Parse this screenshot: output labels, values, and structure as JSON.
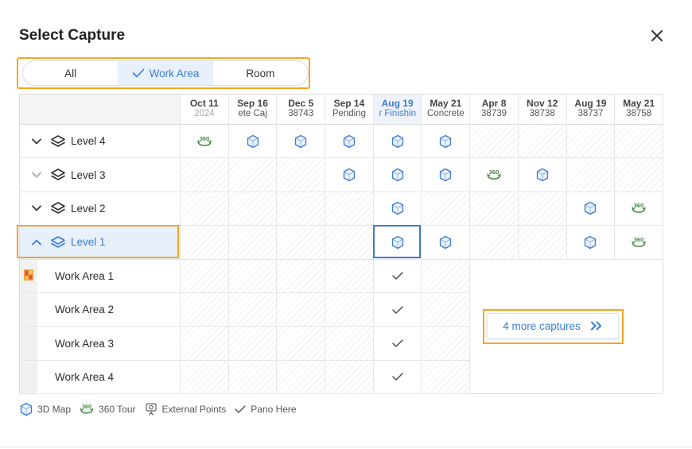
{
  "dialog": {
    "title": "Select Capture",
    "close_icon": "close-icon"
  },
  "tabs": [
    {
      "label": "All",
      "active": false
    },
    {
      "label": "Work Area",
      "active": true,
      "icon": "check-icon"
    },
    {
      "label": "Room",
      "active": false
    }
  ],
  "columns": [
    {
      "date": "Oct 11",
      "sub": "2024",
      "muted": true
    },
    {
      "date": "Sep 16",
      "sub": "ete   Caj"
    },
    {
      "date": "Dec 5",
      "sub": "38743"
    },
    {
      "date": "Sep 14",
      "sub": "Pending"
    },
    {
      "date": "Aug 19",
      "sub": "r Finishin",
      "highlight": true
    },
    {
      "date": "May 21",
      "sub": "Concrete"
    },
    {
      "date": "Apr 8",
      "sub": "38739"
    },
    {
      "date": "Nov 12",
      "sub": "38738"
    },
    {
      "date": "Aug 19",
      "sub": "38737"
    },
    {
      "date": "May 21",
      "sub": "38758"
    }
  ],
  "levels": [
    {
      "label": "Level 4",
      "expanded": true,
      "cells": [
        "360",
        "map",
        "map",
        "map",
        "map",
        "map",
        "",
        "",
        "",
        ""
      ]
    },
    {
      "label": "Level 3",
      "expanded": false,
      "cells": [
        "",
        "",
        "",
        "map",
        "map",
        "map",
        "360",
        "map",
        "",
        ""
      ]
    },
    {
      "label": "Level 2",
      "expanded": true,
      "cells": [
        "",
        "",
        "",
        "",
        "map",
        "",
        "",
        "",
        "map",
        "360"
      ]
    },
    {
      "label": "Level 1",
      "expanded": true,
      "selected": true,
      "cells": [
        "",
        "",
        "",
        "",
        "map",
        "map",
        "",
        "",
        "map",
        "360"
      ]
    }
  ],
  "work_areas": [
    {
      "label": "Work Area 1",
      "icon": "floorplan-icon"
    },
    {
      "label": "Work Area 2"
    },
    {
      "label": "Work Area 3"
    },
    {
      "label": "Work Area 4"
    }
  ],
  "more_captures": {
    "label": "4 more captures",
    "icon": "double-chevron-right-icon"
  },
  "legend": [
    {
      "label": "3D Map",
      "icon": "map-3d-icon"
    },
    {
      "label": "360 Tour",
      "icon": "tour-360-icon"
    },
    {
      "label": "External Points",
      "icon": "external-points-icon"
    },
    {
      "label": "Pano Here",
      "icon": "check-icon"
    }
  ],
  "colors": {
    "accent": "#3a7bd5",
    "highlight_frame": "#f5a623",
    "tour_green": "#3d8a3a"
  }
}
